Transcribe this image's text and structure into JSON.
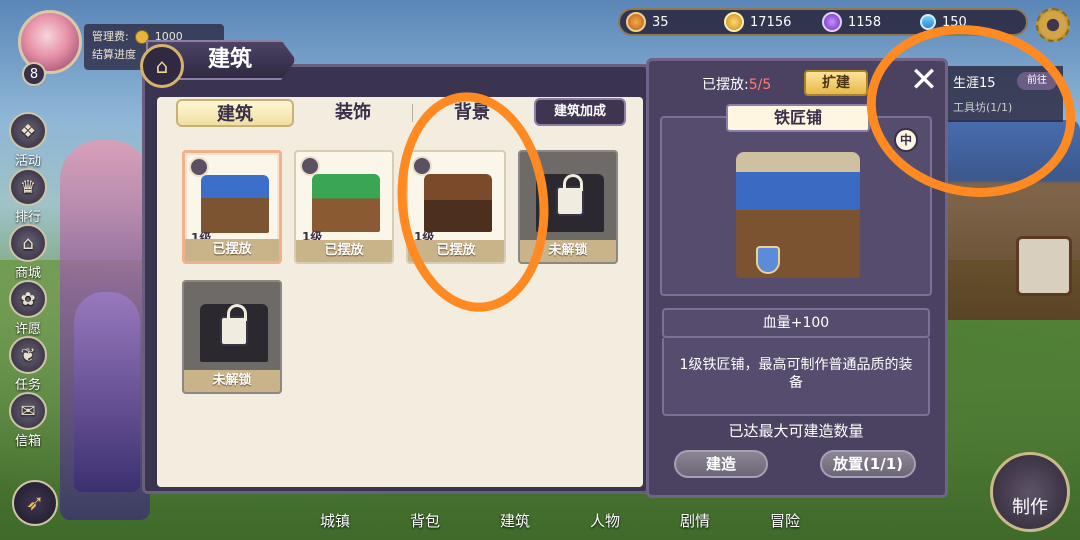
{
  "player": {
    "level": "8",
    "fee_label": "管理费:",
    "fee_value": "1000",
    "settle_label": "结算进度"
  },
  "resources": [
    {
      "icon": "medal-icon",
      "value": "35"
    },
    {
      "icon": "gold-coin-icon",
      "value": "17156"
    },
    {
      "icon": "purple-gem-icon",
      "value": "1158"
    },
    {
      "icon": "diamond-icon",
      "value": "150"
    }
  ],
  "left_menu": [
    {
      "label": "活动",
      "icon": "gift-icon"
    },
    {
      "label": "排行",
      "icon": "trophy-icon"
    },
    {
      "label": "商城",
      "icon": "shop-icon"
    },
    {
      "label": "许愿",
      "icon": "flower-icon"
    },
    {
      "label": "任务",
      "icon": "wreath-icon"
    },
    {
      "label": "信箱",
      "icon": "envelope-icon"
    }
  ],
  "bottom_nav": [
    {
      "label": "城镇"
    },
    {
      "label": "背包"
    },
    {
      "label": "建筑"
    },
    {
      "label": "人物"
    },
    {
      "label": "剧情"
    },
    {
      "label": "冒险"
    }
  ],
  "craft_label": "制作",
  "quest": {
    "title": "生涯15",
    "button": "前往",
    "sub": "工具坊(1/1)"
  },
  "building_panel": {
    "title": "建筑",
    "tabs": [
      {
        "label": "建筑",
        "active": true
      },
      {
        "label": "装饰",
        "active": false
      },
      {
        "label": "背景",
        "active": false
      }
    ],
    "boost_label": "建筑加成",
    "cards": [
      {
        "level": "1级",
        "status": "已摆放",
        "art": "blue",
        "selected": true,
        "locked": false
      },
      {
        "level": "1级",
        "status": "已摆放",
        "art": "green",
        "selected": false,
        "locked": false
      },
      {
        "level": "1级",
        "status": "已摆放",
        "art": "brown",
        "selected": false,
        "locked": false
      },
      {
        "level": "",
        "status": "未解锁",
        "art": "dark",
        "selected": false,
        "locked": true
      },
      {
        "level": "",
        "status": "未解锁",
        "art": "dark",
        "selected": false,
        "locked": true
      }
    ]
  },
  "detail": {
    "placed_label": "已摆放:",
    "placed_value": "5/5",
    "expand_label": "扩建",
    "name": "铁匠铺",
    "info_icon": "中",
    "stat": "血量+100",
    "description": "1级铁匠铺，最高可制作普通品质的装备",
    "max_text": "已达最大可建造数量",
    "build_label": "建造",
    "place_label": "放置(1/1)"
  },
  "colors": {
    "panel_bg": "#3b3450",
    "card_bg": "#fbf6ea",
    "status_bar": "#c9b48a",
    "annotation_ring": "#ff8a22",
    "placed_count_red": "#ff7a7a"
  }
}
